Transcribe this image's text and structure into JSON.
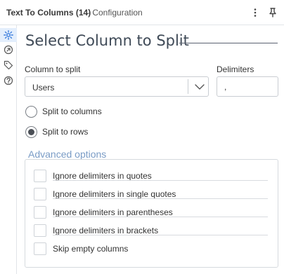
{
  "header": {
    "title": "Text To Columns (14)",
    "subtitle": "- Configuration",
    "more_icon": "more-vertical-icon",
    "pin_icon": "pin-icon"
  },
  "rail": {
    "items": [
      "gear-icon",
      "connection-icon",
      "tag-icon",
      "help-icon"
    ],
    "active_color": "#3b7ddd"
  },
  "main": {
    "heading": "Select Column to Split",
    "column_label": "Column to split",
    "column_value": "Users",
    "delimiters_label": "Delimiters",
    "delimiters_value": ",",
    "radio_options": [
      {
        "label": "Split to columns",
        "checked": false
      },
      {
        "label": "Split to rows",
        "checked": true
      }
    ]
  },
  "advanced": {
    "title": "Advanced options",
    "options": [
      {
        "label": "Ignore delimiters in quotes",
        "checked": false
      },
      {
        "label": "Ignore delimiters in single quotes",
        "checked": false
      },
      {
        "label": "Ignore delimiters in parentheses",
        "checked": false
      },
      {
        "label": "Ignore delimiters in brackets",
        "checked": false
      },
      {
        "label": "Skip empty columns",
        "checked": false
      }
    ]
  }
}
